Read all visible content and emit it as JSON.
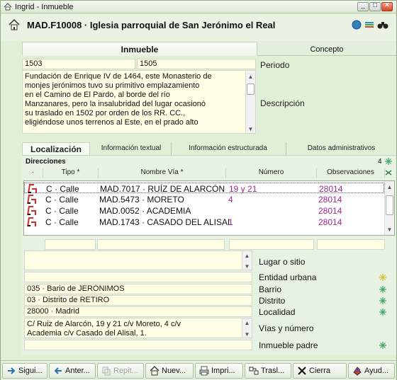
{
  "window": {
    "title": "Ingrid - Inmueble"
  },
  "header": {
    "title": "MAD.F10008 · Iglesia parroquial de San Jerónimo el Real"
  },
  "tabs": {
    "inmueble": "Inmueble",
    "concepto": "Concepto"
  },
  "form": {
    "year_start": "1503",
    "year_end": "1505",
    "periodo_label": "Periodo",
    "descripcion_label": "Descripción",
    "descripcion_lines": [
      "Fundación de Enrique IV de 1464, este Monasterio de",
      "monjes jerónimos tuvo su primitivo emplazamiento",
      "en el Camino de El Pardo, al borde del río",
      "Manzanares, pero la insalubridad del lugar ocasionó",
      "su traslado en 1502 por orden de los RR. CC.,",
      "eligiéndose unos terrenos al Este, en el prado alto"
    ]
  },
  "subtabs": [
    "Localización",
    "Información textual",
    "Información estructurada",
    "Datos administrativos"
  ],
  "direcciones": {
    "label": "Direcciones",
    "count": "4",
    "columns": [
      "·",
      "Tipo *",
      "Nombre Vía *",
      "Número",
      "Observaciones"
    ],
    "rows": [
      {
        "tipo": "C · Calle",
        "via": "MAD.7017 · RUÍZ DE ALARCÓN",
        "numero": "19 y 21",
        "obs": "28014"
      },
      {
        "tipo": "C · Calle",
        "via": "MAD.5473 · MORETO",
        "numero": "4",
        "obs": "28014"
      },
      {
        "tipo": "C · Calle",
        "via": "MAD.0052 · ACADEMIA",
        "numero": "",
        "obs": "28014"
      },
      {
        "tipo": "C · Calle",
        "via": "MAD.1743 · CASADO DEL ALISAL",
        "numero": "1",
        "obs": "28014"
      }
    ]
  },
  "localizacion": {
    "lugar_label": "Lugar o sitio",
    "entidad_label": "Entidad urbana",
    "barrio_value": "035 · Bario de JERÓNIMOS",
    "barrio_label": "Barrio",
    "distrito_value": "03 · Distrito de RETIRO",
    "distrito_label": "Distrito",
    "localidad_value": "28000 · Madrid",
    "localidad_label": "Localidad",
    "vias_lines": [
      "C/ Ruiz de Alarcón, 19 y 21 c/v Moreto, 4 c/v",
      "Academia c/v Casado del Alisal, 1."
    ],
    "vias_label": "Vías y número",
    "padre_label": "Inmueble padre"
  },
  "toolbar": {
    "siguiente": "Sigui...",
    "anterior": "Anter...",
    "repetir": "Repit...",
    "nuevo": "Nuev...",
    "imprimir": "Impri...",
    "trasladar": "Trasl...",
    "cierra": "Cierra",
    "ayuda": "Ayud..."
  },
  "colors": {
    "background": "#dff0d6",
    "field": "#ffffe5",
    "accent_value": "#a0298f",
    "row_icon": "#d32a2a"
  }
}
